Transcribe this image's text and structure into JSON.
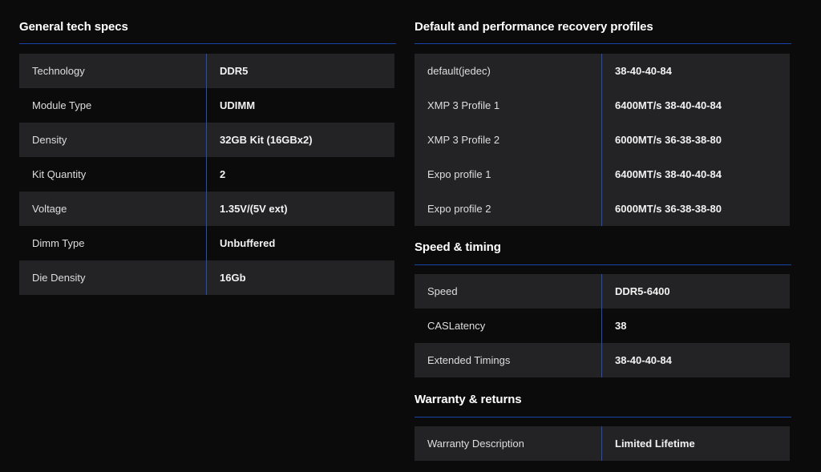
{
  "general": {
    "title": "General tech specs",
    "rows": [
      {
        "key": "Technology",
        "value": "DDR5"
      },
      {
        "key": "Module Type",
        "value": "UDIMM"
      },
      {
        "key": "Density",
        "value": "32GB Kit (16GBx2)"
      },
      {
        "key": "Kit Quantity",
        "value": "2"
      },
      {
        "key": "Voltage",
        "value": "1.35V/(5V ext)"
      },
      {
        "key": "Dimm Type",
        "value": "Unbuffered"
      },
      {
        "key": "Die Density",
        "value": "16Gb"
      }
    ]
  },
  "profiles": {
    "title": "Default and performance recovery profiles",
    "rows": [
      {
        "key": "default(jedec)",
        "value": "38-40-40-84"
      },
      {
        "key": "XMP 3 Profile 1",
        "value": "6400MT/s 38-40-40-84"
      },
      {
        "key": "XMP 3 Profile 2",
        "value": "6000MT/s 36-38-38-80"
      },
      {
        "key": "Expo profile 1",
        "value": "6400MT/s 38-40-40-84"
      },
      {
        "key": "Expo profile 2",
        "value": "6000MT/s 36-38-38-80"
      }
    ]
  },
  "speed": {
    "title": "Speed & timing",
    "rows": [
      {
        "key": "Speed",
        "value": "DDR5-6400"
      },
      {
        "key": "CASLatency",
        "value": "38"
      },
      {
        "key": "Extended Timings",
        "value": "38-40-40-84"
      }
    ]
  },
  "warranty": {
    "title": "Warranty & returns",
    "rows": [
      {
        "key": "Warranty Description",
        "value": "Limited Lifetime"
      }
    ]
  },
  "colors": {
    "background": "#0b0b0c",
    "row_shade": "#232325",
    "accent_rule": "#1f4fc4",
    "text": "#f2f2f2"
  }
}
